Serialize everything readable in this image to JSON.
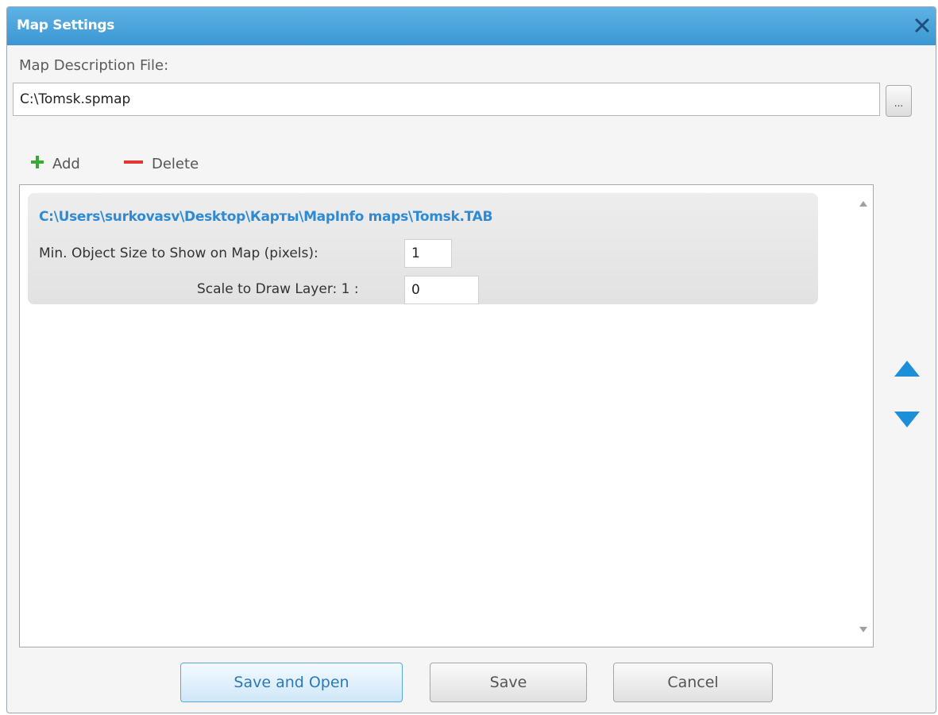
{
  "window": {
    "title": "Map Settings"
  },
  "map_description": {
    "label": "Map Description File:",
    "value": "C:\\Tomsk.spmap",
    "browse_label": "..."
  },
  "toolbar": {
    "add_label": "Add",
    "delete_label": "Delete"
  },
  "layers": [
    {
      "path": "C:\\Users\\surkovasv\\Desktop\\Карты\\MapInfo maps\\Tomsk.TAB",
      "min_size_label": "Min. Object Size to Show on Map (pixels):",
      "min_size_value": "1",
      "scale_label": "Scale to Draw Layer: 1 :",
      "scale_value": "0"
    }
  ],
  "buttons": {
    "save_and_open": "Save and Open",
    "save": "Save",
    "cancel": "Cancel"
  },
  "colors": {
    "titlebar": "#3b97d3",
    "accent": "#1c8fd8",
    "layer_path": "#2f8ad4",
    "add_icon": "#3aa935",
    "delete_icon": "#e0372e"
  },
  "icons": {
    "close": "close-icon",
    "add": "plus-icon",
    "delete": "minus-icon",
    "move_up": "triangle-up-icon",
    "move_down": "triangle-down-icon"
  }
}
